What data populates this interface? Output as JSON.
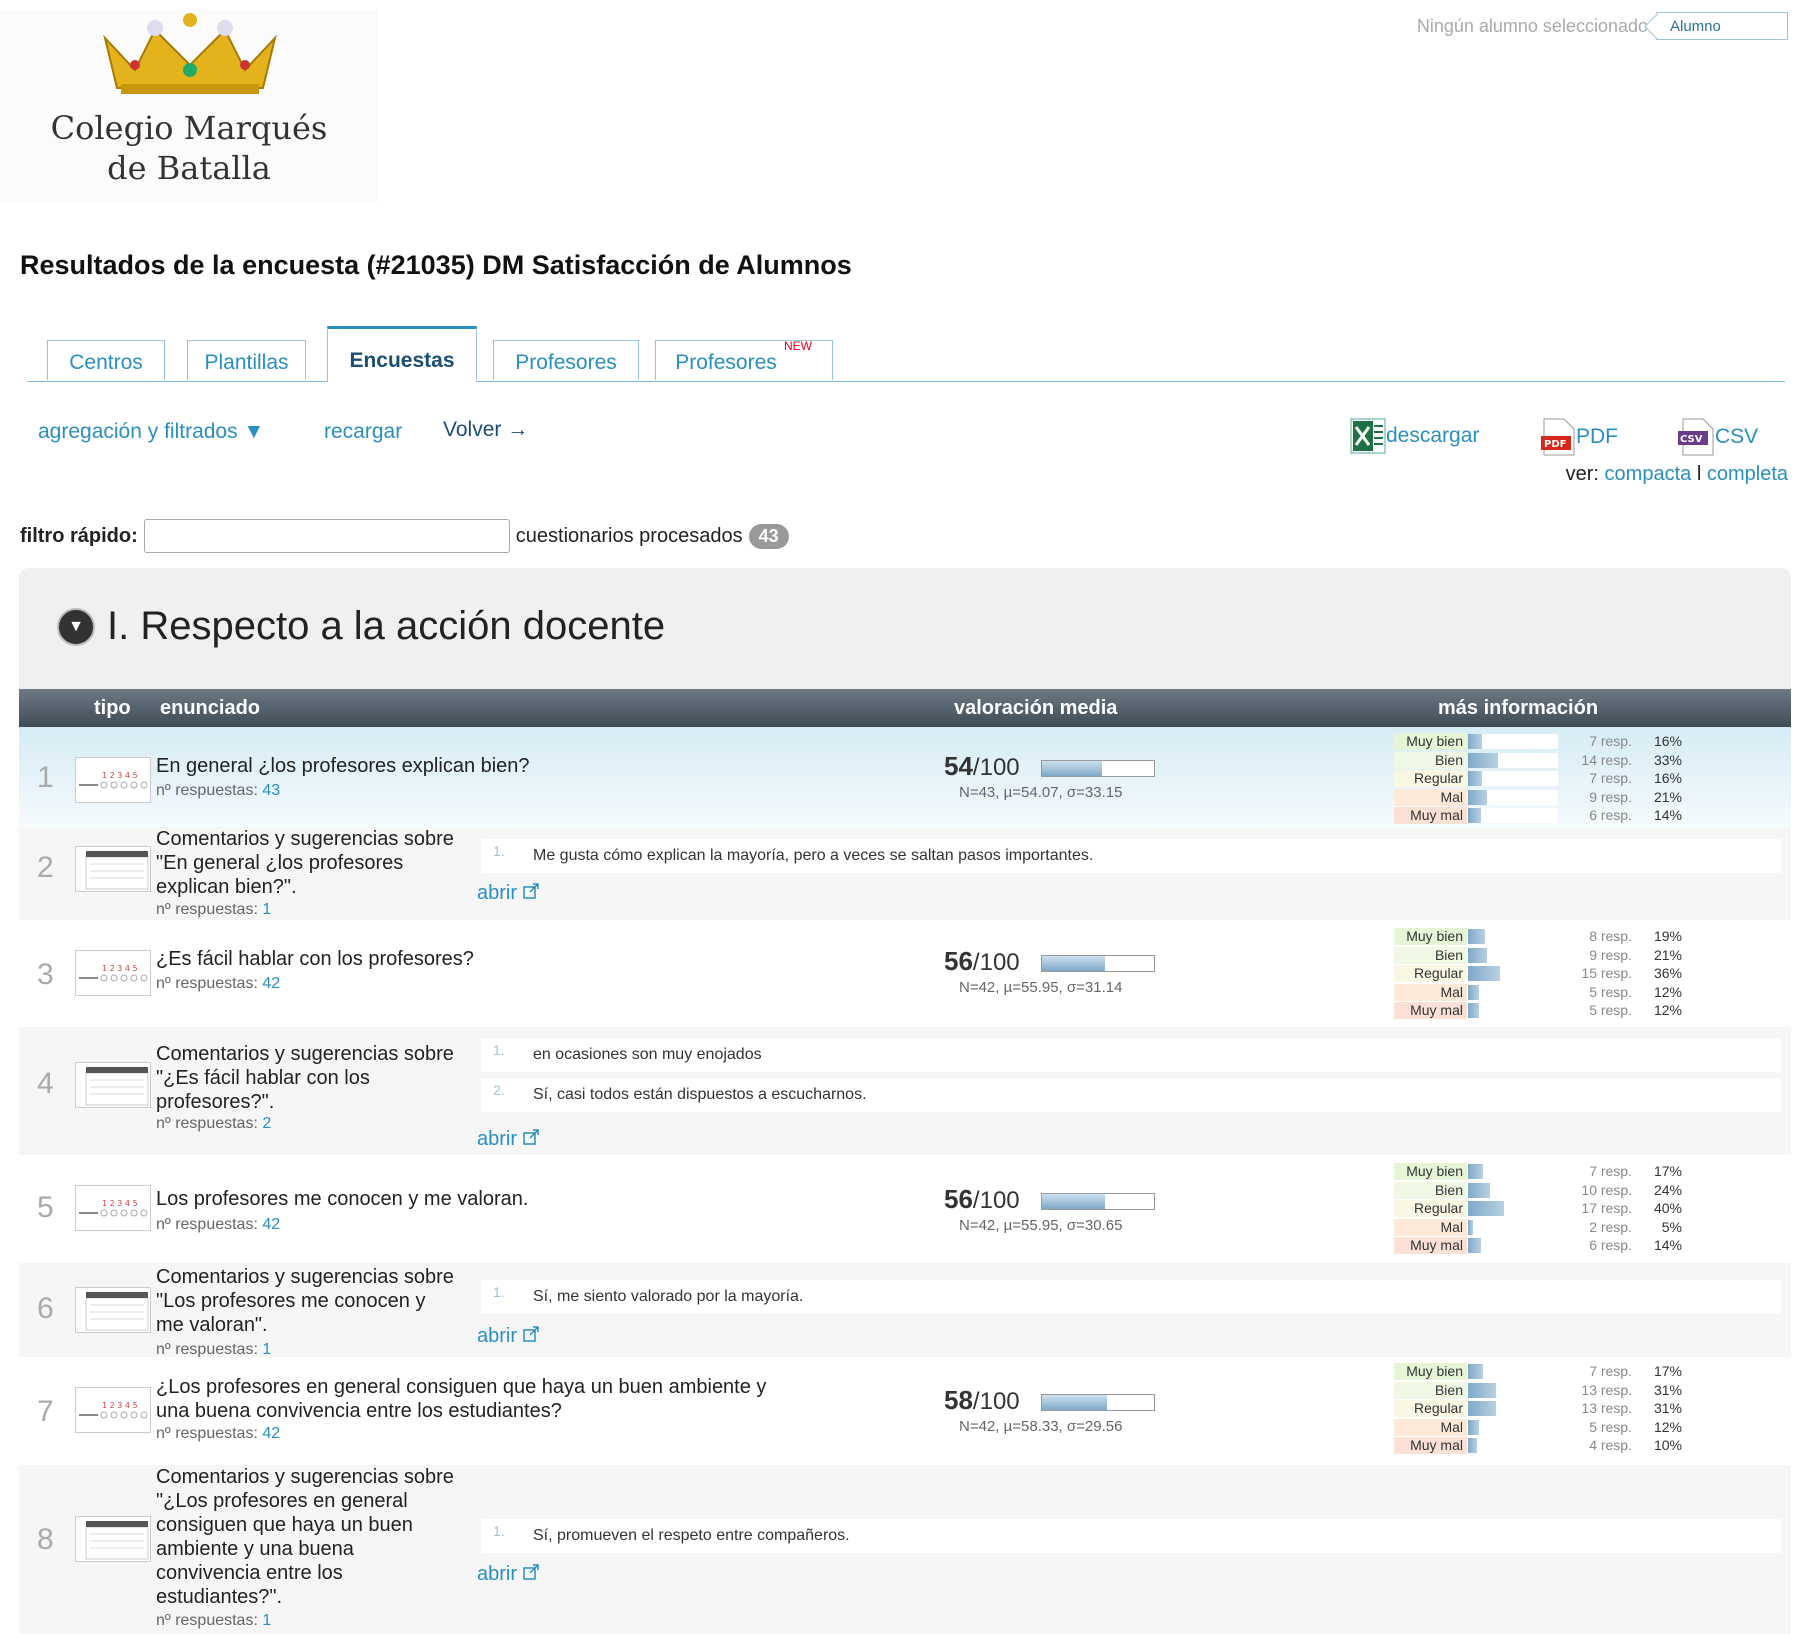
{
  "logo": {
    "line1": "Colegio Marqués",
    "line2": "de Batalla"
  },
  "student": {
    "status": "Ningún alumno seleccionado",
    "selector": "Alumno"
  },
  "title": "Resultados de la encuesta (#21035) DM Satisfacción de Alumnos",
  "tabs": [
    {
      "label": "Centros"
    },
    {
      "label": "Plantillas"
    },
    {
      "label": "Encuestas"
    },
    {
      "label": "Profesores"
    },
    {
      "label": "Profesores",
      "badge": "NEW"
    }
  ],
  "toolbar": {
    "aggregation": "agregación y filtrados ▼",
    "reload": "recargar",
    "back": "Volver →",
    "download": "descargar",
    "pdf": "PDF",
    "csv": "CSV",
    "view_label": "ver:",
    "view_compact": "compacta",
    "view_sep": "l",
    "view_full": "completa"
  },
  "filter": {
    "label": "filtro rápido:",
    "value": "",
    "processed_label": "cuestionarios procesados",
    "processed_count": "43"
  },
  "section": {
    "title": "I. Respecto a la acción docente"
  },
  "columns": {
    "type": "tipo",
    "statement": "enunciado",
    "avg": "valoración media",
    "more": "más información"
  },
  "scale_labels": [
    "Muy bien",
    "Bien",
    "Regular",
    "Mal",
    "Muy mal"
  ],
  "scale_colors": [
    "#e6f5d6",
    "#eef8e4",
    "#f7f7e4",
    "#fde9d8",
    "#fbe0d6"
  ],
  "nresp_label": "nº respuestas:",
  "open_label": "abrir",
  "rows": [
    {
      "n": "1",
      "kind": "rating",
      "question": "En general ¿los profesores explican bien?",
      "responses": "43",
      "score": "54",
      "max": "/100",
      "fill": 0.54,
      "stats": "N=43, µ=54.07, σ=33.15",
      "dist": [
        {
          "c": "7 resp.",
          "p": "16%",
          "f": 0.16
        },
        {
          "c": "14 resp.",
          "p": "33%",
          "f": 0.33
        },
        {
          "c": "7 resp.",
          "p": "16%",
          "f": 0.16
        },
        {
          "c": "9 resp.",
          "p": "21%",
          "f": 0.21
        },
        {
          "c": "6 resp.",
          "p": "14%",
          "f": 0.14
        }
      ]
    },
    {
      "n": "2",
      "kind": "comment",
      "question": "Comentarios y sugerencias sobre \"En general ¿los profesores explican bien?\".",
      "responses": "1",
      "comments": [
        "Me gusta cómo explican la mayoría, pero a veces se saltan pasos importantes."
      ]
    },
    {
      "n": "3",
      "kind": "rating",
      "question": "¿Es fácil hablar con los profesores?",
      "responses": "42",
      "score": "56",
      "max": "/100",
      "fill": 0.56,
      "stats": "N=42, µ=55.95, σ=31.14",
      "dist": [
        {
          "c": "8 resp.",
          "p": "19%",
          "f": 0.19
        },
        {
          "c": "9 resp.",
          "p": "21%",
          "f": 0.21
        },
        {
          "c": "15 resp.",
          "p": "36%",
          "f": 0.36
        },
        {
          "c": "5 resp.",
          "p": "12%",
          "f": 0.12
        },
        {
          "c": "5 resp.",
          "p": "12%",
          "f": 0.12
        }
      ]
    },
    {
      "n": "4",
      "kind": "comment",
      "question": "Comentarios y sugerencias sobre \"¿Es fácil hablar con los profesores?\".",
      "responses": "2",
      "comments": [
        "en ocasiones son muy enojados",
        "Sí, casi todos están dispuestos a escucharnos."
      ]
    },
    {
      "n": "5",
      "kind": "rating",
      "question": "Los profesores me conocen y me valoran.",
      "responses": "42",
      "score": "56",
      "max": "/100",
      "fill": 0.56,
      "stats": "N=42, µ=55.95, σ=30.65",
      "dist": [
        {
          "c": "7 resp.",
          "p": "17%",
          "f": 0.17
        },
        {
          "c": "10 resp.",
          "p": "24%",
          "f": 0.24
        },
        {
          "c": "17 resp.",
          "p": "40%",
          "f": 0.4
        },
        {
          "c": "2 resp.",
          "p": "5%",
          "f": 0.05
        },
        {
          "c": "6 resp.",
          "p": "14%",
          "f": 0.14
        }
      ]
    },
    {
      "n": "6",
      "kind": "comment",
      "question": "Comentarios y sugerencias sobre \"Los profesores me conocen y me valoran\".",
      "responses": "1",
      "comments": [
        "Sí, me siento valorado por la mayoría."
      ]
    },
    {
      "n": "7",
      "kind": "rating",
      "question": "¿Los profesores en general consiguen que haya un buen ambiente y una buena convivencia entre los estudiantes?",
      "responses": "42",
      "score": "58",
      "max": "/100",
      "fill": 0.58,
      "stats": "N=42, µ=58.33, σ=29.56",
      "dist": [
        {
          "c": "7 resp.",
          "p": "17%",
          "f": 0.17
        },
        {
          "c": "13 resp.",
          "p": "31%",
          "f": 0.31
        },
        {
          "c": "13 resp.",
          "p": "31%",
          "f": 0.31
        },
        {
          "c": "5 resp.",
          "p": "12%",
          "f": 0.12
        },
        {
          "c": "4 resp.",
          "p": "10%",
          "f": 0.1
        }
      ]
    },
    {
      "n": "8",
      "kind": "comment",
      "question": "Comentarios y sugerencias sobre \"¿Los profesores en general consiguen que haya un buen ambiente y una buena convivencia entre los estudiantes?\".",
      "responses": "1",
      "comments": [
        "Sí, promueven el respeto entre compañeros."
      ]
    }
  ]
}
